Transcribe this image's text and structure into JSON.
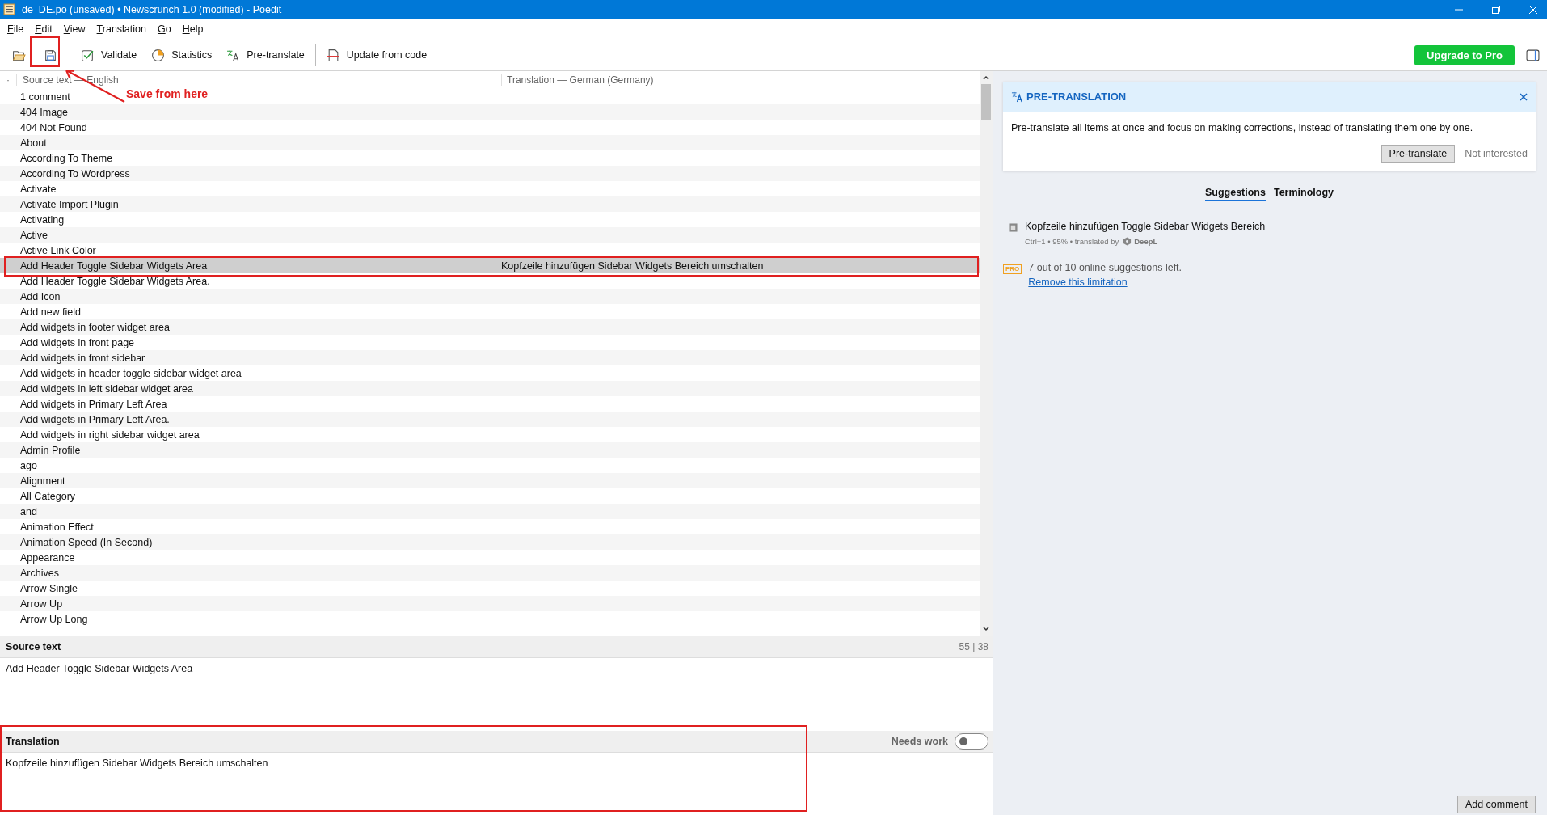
{
  "window": {
    "title": "de_DE.po (unsaved) • Newscrunch 1.0 (modified) - Poedit"
  },
  "menu": [
    "File",
    "Edit",
    "View",
    "Translation",
    "Go",
    "Help"
  ],
  "toolbar": [
    {
      "kind": "open"
    },
    {
      "kind": "save"
    },
    {
      "kind": "validate",
      "label": "Validate"
    },
    {
      "kind": "statistics",
      "label": "Statistics"
    },
    {
      "kind": "pretranslate",
      "label": "Pre-translate"
    },
    {
      "kind": "update",
      "label": "Update from code"
    }
  ],
  "upgrade_button": "Upgrade to Pro",
  "list": {
    "marker": "·",
    "columns": [
      "Source text — English",
      "Translation — German (Germany)"
    ],
    "rows": [
      {
        "source": "1 comment",
        "selected": false
      },
      {
        "source": "404 Image",
        "selected": false
      },
      {
        "source": "404 Not Found",
        "selected": false
      },
      {
        "source": "About",
        "selected": false
      },
      {
        "source": "According To Theme",
        "selected": false
      },
      {
        "source": "According To Wordpress",
        "selected": false
      },
      {
        "source": "Activate",
        "selected": false
      },
      {
        "source": "Activate Import Plugin",
        "selected": false
      },
      {
        "source": "Activating",
        "selected": false
      },
      {
        "source": "Active",
        "selected": false
      },
      {
        "source": "Active Link Color",
        "selected": false
      },
      {
        "source": "Add Header Toggle Sidebar Widgets Area",
        "translation": "Kopfzeile hinzufügen Sidebar Widgets Bereich umschalten",
        "selected": true
      },
      {
        "source": "Add Header Toggle Sidebar Widgets Area.",
        "selected": false
      },
      {
        "source": "Add Icon",
        "selected": false
      },
      {
        "source": "Add new field",
        "selected": false
      },
      {
        "source": "Add widgets in footer widget area",
        "selected": false
      },
      {
        "source": "Add widgets in front page",
        "selected": false
      },
      {
        "source": "Add widgets in front sidebar",
        "selected": false
      },
      {
        "source": "Add widgets in header toggle sidebar widget area",
        "selected": false
      },
      {
        "source": "Add widgets in left sidebar widget area",
        "selected": false
      },
      {
        "source": "Add widgets in Primary Left Area",
        "selected": false
      },
      {
        "source": "Add widgets in Primary Left Area.",
        "selected": false
      },
      {
        "source": "Add widgets in right sidebar widget area",
        "selected": false
      },
      {
        "source": "Admin Profile",
        "selected": false
      },
      {
        "source": "ago",
        "selected": false
      },
      {
        "source": "Alignment",
        "selected": false
      },
      {
        "source": "All Category",
        "selected": false
      },
      {
        "source": "and",
        "selected": false
      },
      {
        "source": "Animation Effect",
        "selected": false
      },
      {
        "source": "Animation Speed (In Second)",
        "selected": false
      },
      {
        "source": "Appearance",
        "selected": false
      },
      {
        "source": "Archives",
        "selected": false
      },
      {
        "source": "Arrow Single",
        "selected": false
      },
      {
        "source": "Arrow Up",
        "selected": false
      },
      {
        "source": "Arrow Up Long",
        "selected": false
      }
    ]
  },
  "source_panel": {
    "title": "Source text",
    "counter": "55 | 38",
    "text": "Add Header Toggle Sidebar Widgets Area"
  },
  "translation_panel": {
    "title": "Translation",
    "needs_work_label": "Needs work",
    "needs_work": {
      "on": false
    },
    "text": "Kopfzeile hinzufügen Sidebar Widgets Bereich umschalten"
  },
  "pretranslation_card": {
    "title": "PRE-TRANSLATION",
    "text": "Pre-translate all items at once and focus on making corrections, instead of translating them one by one.",
    "button": "Pre-translate",
    "link": "Not interested"
  },
  "side_tabs": [
    {
      "label": "Suggestions",
      "selected": true
    },
    {
      "label": "Terminology",
      "selected": false
    }
  ],
  "suggestion": {
    "text": "Kopfzeile hinzufügen Toggle Sidebar Widgets Bereich",
    "meta": "Ctrl+1 • 95% • translated by",
    "provider": "DeepL"
  },
  "limit_notice": {
    "badge": "PRO",
    "text": "7 out of 10 online suggestions left.",
    "link": "Remove this limitation"
  },
  "add_comment_button": "Add comment",
  "annotation": {
    "label": "Save from here"
  }
}
